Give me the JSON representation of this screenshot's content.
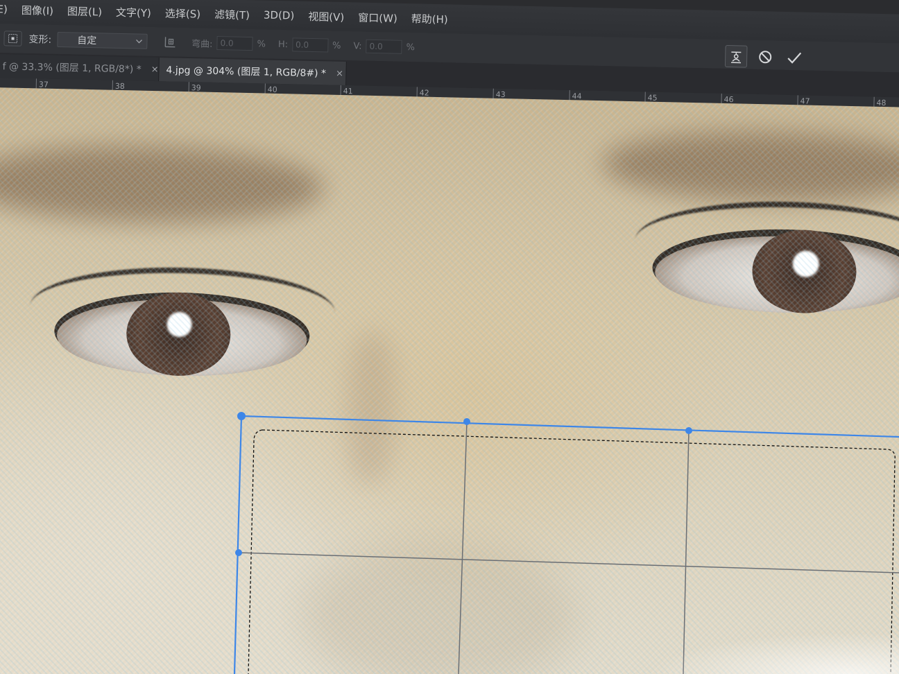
{
  "menu": {
    "items": [
      {
        "label": "E)"
      },
      {
        "label": "图像(I)"
      },
      {
        "label": "图层(L)"
      },
      {
        "label": "文字(Y)"
      },
      {
        "label": "选择(S)"
      },
      {
        "label": "滤镜(T)"
      },
      {
        "label": "3D(D)"
      },
      {
        "label": "视图(V)"
      },
      {
        "label": "窗口(W)"
      },
      {
        "label": "帮助(H)"
      }
    ]
  },
  "options": {
    "warp_label": "变形:",
    "warp_value": "自定",
    "bend_label": "弯曲:",
    "bend_value": "0.0",
    "h_label": "H:",
    "h_value": "0.0",
    "v_label": "V:",
    "v_value": "0.0",
    "pct": "%",
    "cancel_icon": "⃠",
    "commit_icon": "✓"
  },
  "tabs": [
    {
      "label": "f @ 33.3% (图层 1, RGB/8*) *",
      "close": "×",
      "active": false
    },
    {
      "label": "4.jpg @ 304% (图层 1, RGB/8#) *",
      "close": "×",
      "active": true
    }
  ],
  "ruler": {
    "labels": [
      "37",
      "38",
      "39",
      "40",
      "41",
      "42",
      "43",
      "44",
      "45",
      "46",
      "47",
      "48"
    ]
  },
  "icons": {
    "tool": "warp-tool-icon",
    "toggle": "warp-grid-toggle-icon",
    "puppet": "puppet-warp-icon",
    "cancel": "cancel-transform-icon",
    "commit": "commit-transform-icon"
  }
}
